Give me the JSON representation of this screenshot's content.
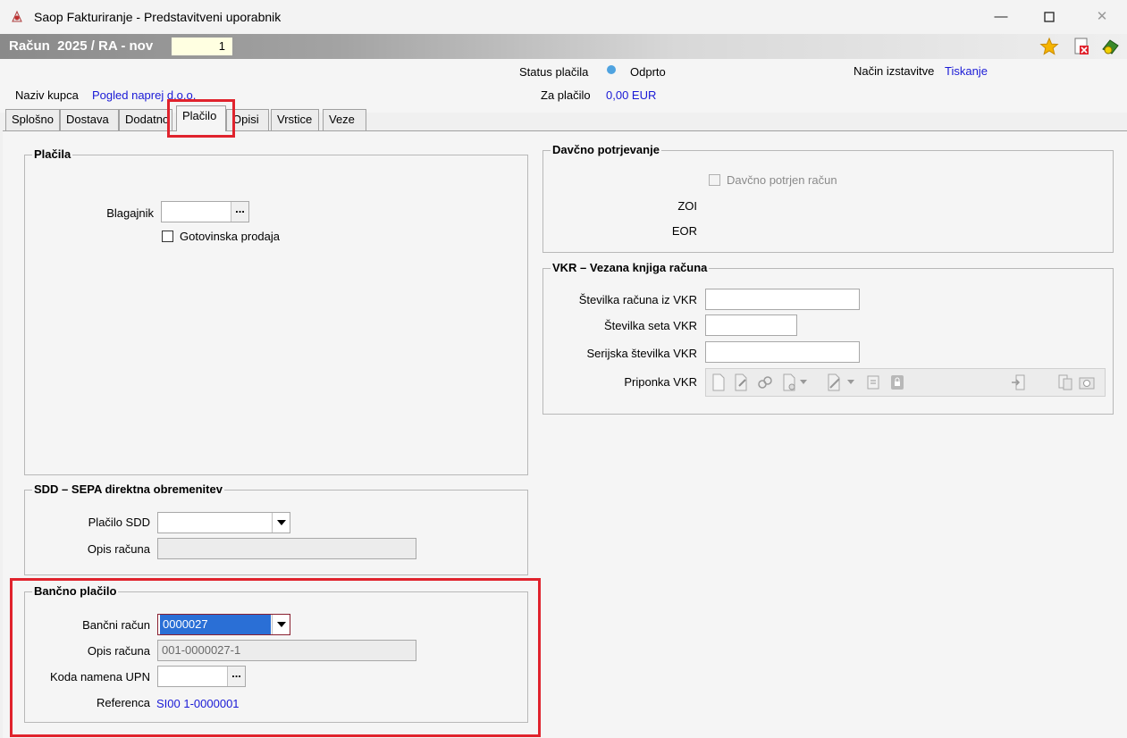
{
  "window": {
    "title": "Saop Fakturiranje - Predstavitveni uporabnik"
  },
  "document": {
    "title": "Račun  2025 / RA - nov",
    "number": "1"
  },
  "header": {
    "status_label": "Status plačila",
    "status_value": "Odprto",
    "issue_label": "Način izstavitve",
    "issue_value": "Tiskanje",
    "customer_label": "Naziv kupca",
    "customer_value": "Pogled naprej d.o.o.",
    "payable_label": "Za plačilo",
    "payable_value": "0,00 EUR"
  },
  "tabs": [
    "Splošno",
    "Dostava",
    "Dodatno",
    "Plačilo",
    "Opisi",
    "Vrstice",
    "Veze"
  ],
  "placila": {
    "title": "Plačila",
    "blagajnik_label": "Blagajnik",
    "gotovinska_label": "Gotovinska prodaja"
  },
  "sdd": {
    "title": "SDD – SEPA direktna obremenitev",
    "placilo_label": "Plačilo SDD",
    "opis_label": "Opis računa"
  },
  "bancno": {
    "title": "Bančno plačilo",
    "racun_label": "Bančni račun",
    "racun_value": "0000027",
    "opis_label": "Opis računa",
    "opis_value": "001-0000027-1",
    "koda_label": "Koda namena UPN",
    "referenca_label": "Referenca",
    "referenca_value": "SI00 1-0000001"
  },
  "davcno": {
    "title": "Davčno potrjevanje",
    "check_label": "Davčno potrjen račun",
    "zoi_label": "ZOI",
    "eor_label": "EOR"
  },
  "vkr": {
    "title": "VKR – Vezana knjiga računa",
    "stevilka_label": "Številka računa iz VKR",
    "set_label": "Številka seta VKR",
    "serijska_label": "Serijska številka VKR",
    "priponka_label": "Priponka VKR"
  },
  "colors": {
    "accent_red": "#e0232d",
    "link_blue": "#1a1ad6",
    "status_dot": "#4fa3e0"
  }
}
